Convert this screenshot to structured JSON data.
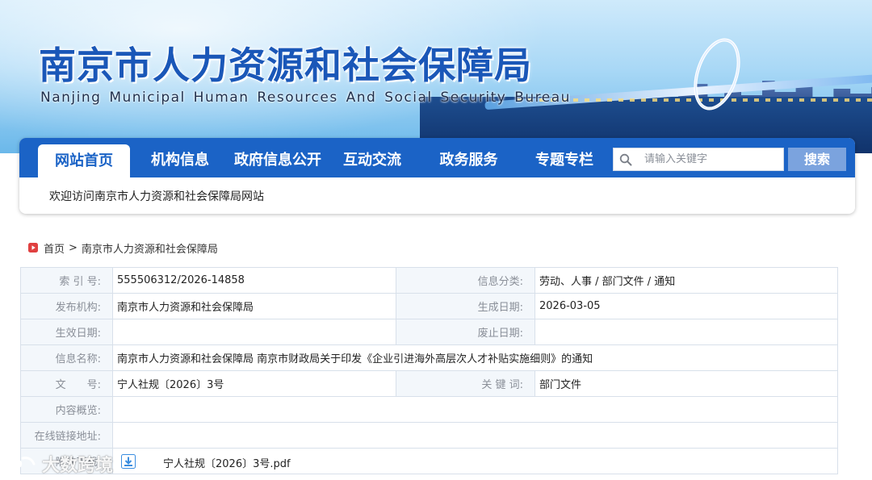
{
  "banner": {
    "title_zh": "南京市人力资源和社会保障局",
    "title_en": "Nanjing Municipal Human Resources And Social Security Bureau"
  },
  "nav": {
    "items": [
      {
        "label": "网站首页",
        "active": true
      },
      {
        "label": "机构信息"
      },
      {
        "label": "政府信息公开"
      },
      {
        "label": "互动交流"
      },
      {
        "label": "政务服务"
      },
      {
        "label": "专题专栏"
      }
    ],
    "search": {
      "placeholder": "请输入关键字",
      "button_label": "搜索"
    },
    "welcome": "欢迎访问南京市人力资源和社会保障局网站"
  },
  "breadcrumb": {
    "home": "首页",
    "separator": ">",
    "current": "南京市人力资源和社会保障局"
  },
  "info": {
    "index_label": "索 引 号:",
    "index_value": "555506312/2026-14858",
    "category_label": "信息分类:",
    "category_value": "劳动、人事 / 部门文件 / 通知",
    "publisher_label": "发布机构:",
    "publisher_value": "南京市人力资源和社会保障局",
    "created_label": "生成日期:",
    "created_value": "2026-03-05",
    "effective_label": "生效日期:",
    "effective_value": "",
    "expire_label": "废止日期:",
    "expire_value": "",
    "name_label": "信息名称:",
    "name_value": "南京市人力资源和社会保障局 南京市财政局关于印发《企业引进海外高层次人才补贴实施细则》的通知",
    "docno_label": "文　　号:",
    "docno_value": "宁人社规〔2026〕3号",
    "keywords_label": "关 键 词:",
    "keywords_value": "部门文件",
    "summary_label": "内容概览:",
    "summary_value": "",
    "link_label": "在线链接地址:",
    "link_value": "",
    "attachment_label": "附件下载:",
    "attachment_value": "宁人社规〔2026〕3号.pdf"
  },
  "watermark": {
    "text": "大数跨境"
  },
  "colors": {
    "nav_blue": "#1b63c6",
    "label_bg": "#f3f7fb",
    "search_btn": "#7ba3de",
    "title_blue": "#1a57b8"
  }
}
